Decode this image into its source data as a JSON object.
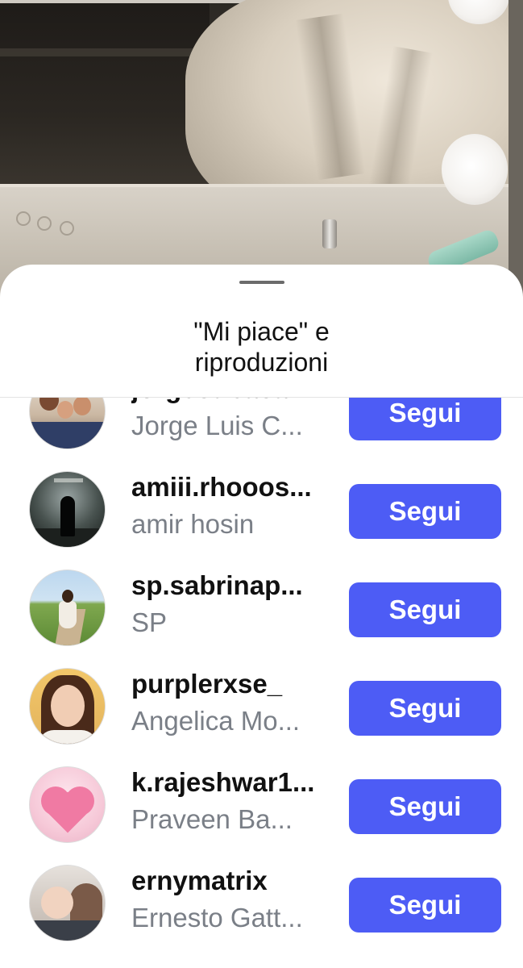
{
  "sheet": {
    "title": "\"Mi piace\" e riproduzioni"
  },
  "accent_color": "#4d5cf5",
  "users": [
    {
      "username": "jorgecubaca...",
      "fullname": "Jorge Luis C...",
      "button_label": "Segui",
      "avatar": "family-photo"
    },
    {
      "username": "amiii.rhooos...",
      "fullname": "amir hosin",
      "button_label": "Segui",
      "avatar": "movie-poster"
    },
    {
      "username": "sp.sabrinap...",
      "fullname": "SP",
      "button_label": "Segui",
      "avatar": "woman-in-field"
    },
    {
      "username": "purplerxse_",
      "fullname": "Angelica Mo...",
      "button_label": "Segui",
      "avatar": "selfie-portrait"
    },
    {
      "username": "k.rajeshwar1...",
      "fullname": "Praveen Ba...",
      "button_label": "Segui",
      "avatar": "pink-heart"
    },
    {
      "username": "ernymatrix",
      "fullname": "Ernesto Gatt...",
      "button_label": "Segui",
      "avatar": "man-with-baby"
    }
  ]
}
